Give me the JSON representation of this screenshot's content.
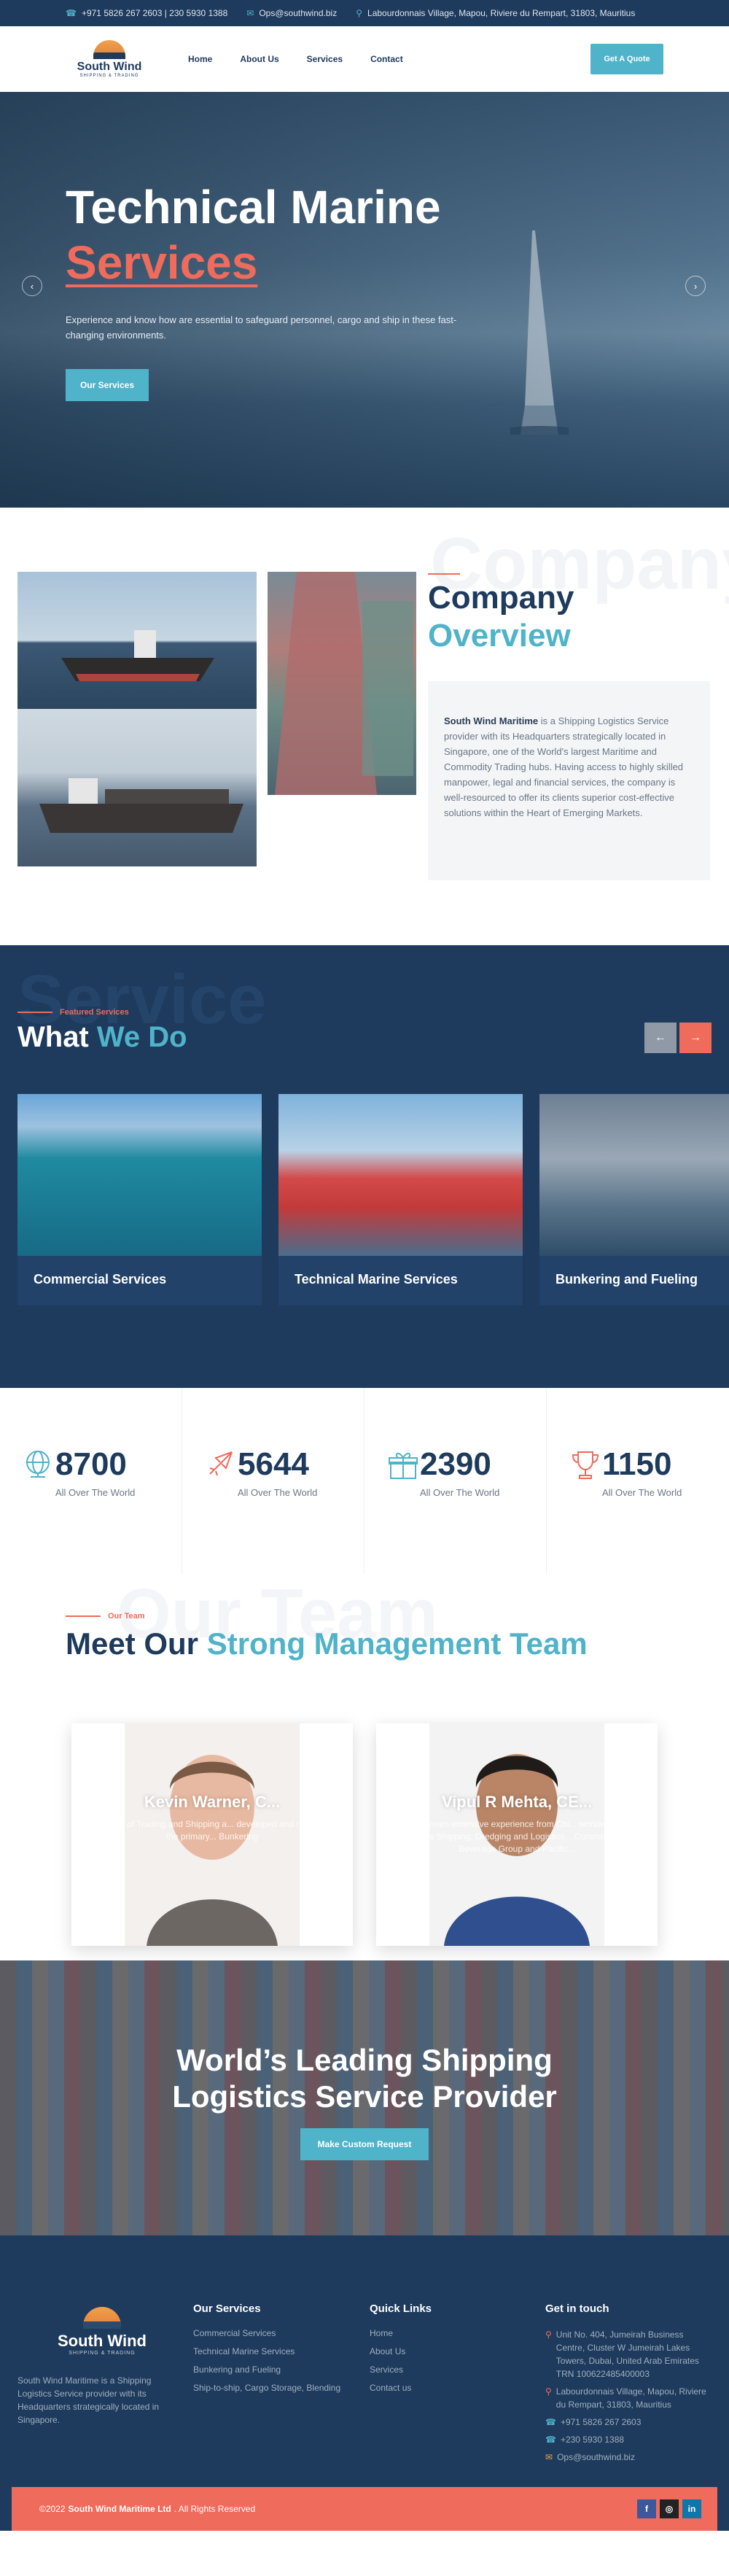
{
  "topbar": {
    "phone": "+971 5826 267 2603 | 230 5930 1388",
    "email": "Ops@southwind.biz",
    "address": "Labourdonnais Village, Mapou, Riviere du Rempart, 31803, Mauritius"
  },
  "brand": {
    "name": "South Wind",
    "tagline": "SHIPPING & TRADING"
  },
  "nav": {
    "items": [
      "Home",
      "About Us",
      "Services",
      "Contact"
    ],
    "cta": "Get A Quote"
  },
  "hero": {
    "title_line1": "Technical Marine",
    "title_line2": "Services",
    "text": "Experience and know how are essential to safeguard personnel, cargo and ship in these fast-changing environments.",
    "cta": "Our Services"
  },
  "overview": {
    "title_line1": "Company",
    "title_line2": "Overview",
    "company": "South Wind Maritime",
    "body": " is a Shipping Logistics Service provider with its Headquarters strategically located in Singapore, one of the World's largest Maritime and Commodity Trading hubs. Having access to highly skilled manpower, legal and financial services, the company is well-resourced to offer its clients superior cost-effective solutions within the Heart of Emerging Markets."
  },
  "services": {
    "bg_word": "Service",
    "tagline": "Featured Services",
    "title_a": "What",
    "title_b": "We Do",
    "cards": [
      "Commercial Services",
      "Technical Marine Services",
      "Bunkering and Fueling"
    ]
  },
  "counters": [
    {
      "value": "8700",
      "caption": "All Over The World",
      "icon": "globe-icon"
    },
    {
      "value": "5644",
      "caption": "All Over The World",
      "icon": "airplane-icon"
    },
    {
      "value": "2390",
      "caption": "All Over The World",
      "icon": "gift-box-icon"
    },
    {
      "value": "1150",
      "caption": "All Over The World",
      "icon": "trophy-icon"
    }
  ],
  "team": {
    "tagline": "Our Team",
    "title_a": "Meet Our",
    "title_b": "Strong Management Team",
    "members": [
      {
        "name": "Kevin Warner, C...",
        "bio": "Head of Trading and Shipping a... developed and one of the primary... Bunkering"
      },
      {
        "name": "Vipul R Mehta, CE...",
        "bio": "25 years extensive experience from Chi... worldwide across Shipping, Dredging and Logistics... Commerce & Beverage Group and Pacific..."
      }
    ]
  },
  "banner": {
    "title_line1": "World’s Leading Shipping",
    "title_line2": "Logistics Service Provider",
    "cta": "Make Custom Request"
  },
  "footer": {
    "about": "South Wind Maritime is a Shipping Logistics Service provider with its Headquarters strategically located in Singapore.",
    "services_title": "Our Services",
    "services": [
      "Commercial Services",
      "Technical Marine Services",
      "Bunkering and Fueling",
      "Ship-to-ship, Cargo Storage, Blending"
    ],
    "links_title": "Quick Links",
    "links": [
      "Home",
      "About Us",
      "Services",
      "Contact us"
    ],
    "contact_title": "Get in touch",
    "address1": "Unit No. 404, Jumeirah Business Centre, Cluster W Jumeirah Lakes Towers, Dubai, United Arab Emirates TRN 100622485400003",
    "address2": "Labourdonnais Village, Mapou, Riviere du Rempart, 31803, Mauritius",
    "phone1": "+971 5826 267 2603",
    "phone2": "+230 5930 1388",
    "email": "Ops@southwind.biz",
    "copyright_pre": "©2022",
    "copyright_company": "South Wind Maritime Ltd",
    "copyright_post": ". All Rights Reserved"
  },
  "colors": {
    "navy": "#1e3a5c",
    "teal": "#4fb3c9",
    "coral": "#ef6b5c"
  }
}
